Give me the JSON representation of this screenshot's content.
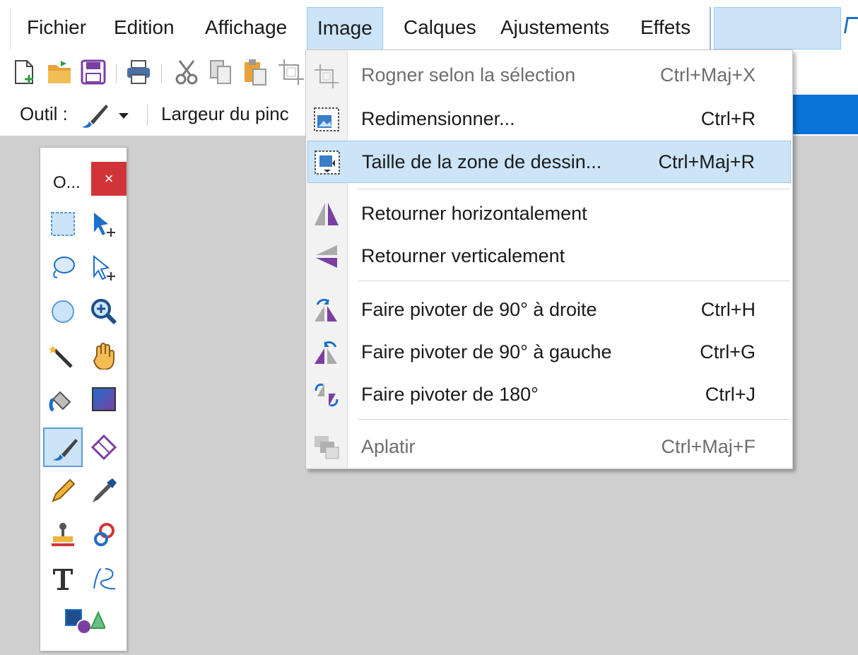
{
  "menubar": {
    "items": [
      "Fichier",
      "Edition",
      "Affichage",
      "Image",
      "Calques",
      "Ajustements",
      "Effets"
    ],
    "open_index": 3
  },
  "toolbar": {
    "icons": [
      "new-file-icon",
      "open-file-icon",
      "save-icon",
      "print-icon",
      "cut-icon",
      "copy-icon",
      "paste-icon",
      "crop-icon"
    ]
  },
  "options": {
    "tool_label": "Outil :",
    "brush_width_label": "Largeur du pinc"
  },
  "tools_window": {
    "title": "O...",
    "close": "×"
  },
  "image_menu": {
    "items": [
      {
        "label": "Rogner selon la sélection",
        "shortcut": "Ctrl+Maj+X",
        "icon": "crop-selection-icon",
        "disabled": true
      },
      {
        "label": "Redimensionner...",
        "shortcut": "Ctrl+R",
        "icon": "resize-icon",
        "disabled": false
      },
      {
        "label": "Taille de la zone de dessin...",
        "shortcut": "Ctrl+Maj+R",
        "icon": "canvas-size-icon",
        "disabled": false,
        "highlighted": true
      },
      {
        "label": "Retourner horizontalement",
        "shortcut": "",
        "icon": "flip-horizontal-icon",
        "disabled": false
      },
      {
        "label": "Retourner verticalement",
        "shortcut": "",
        "icon": "flip-vertical-icon",
        "disabled": false
      },
      {
        "label": "Faire pivoter de 90° à droite",
        "shortcut": "Ctrl+H",
        "icon": "rotate-right-icon",
        "disabled": false
      },
      {
        "label": "Faire pivoter de 90° à gauche",
        "shortcut": "Ctrl+G",
        "icon": "rotate-left-icon",
        "disabled": false
      },
      {
        "label": "Faire pivoter de 180°",
        "shortcut": "Ctrl+J",
        "icon": "rotate-180-icon",
        "disabled": false
      },
      {
        "label": "Aplatir",
        "shortcut": "Ctrl+Maj+F",
        "icon": "flatten-icon",
        "disabled": true
      }
    ]
  },
  "colors": {
    "menu_highlight": "#cce4f7",
    "menu_highlight_border": "#99c9ef",
    "accent_blue": "#0a73d9",
    "close_red": "#d13438",
    "canvas_gray": "#cfcfcf",
    "icon_purple": "#7b3fa3"
  }
}
